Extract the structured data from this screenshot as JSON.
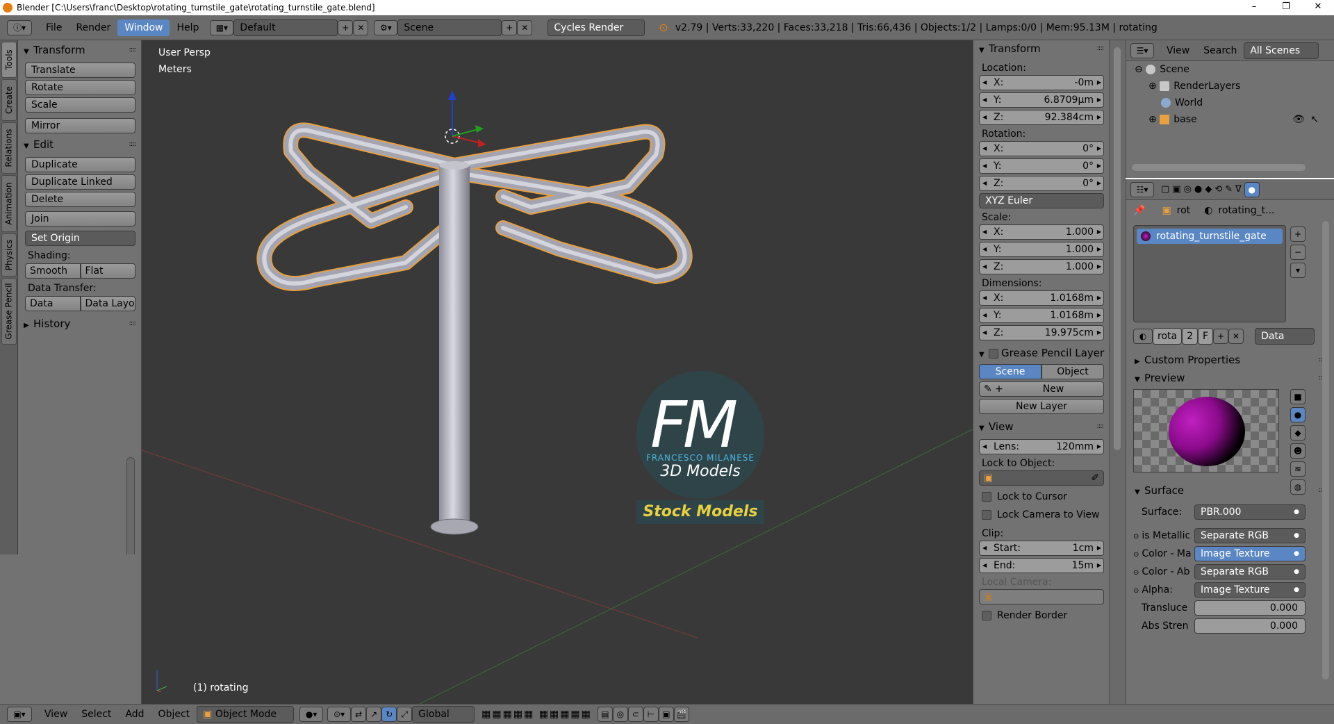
{
  "window": {
    "title": "Blender [C:\\Users\\franc\\Desktop\\rotating_turnstile_gate\\rotating_turnstile_gate.blend]",
    "controls": {
      "minimize": "–",
      "maximize": "❐",
      "close": "✕"
    }
  },
  "topbar": {
    "menus": [
      "File",
      "Render",
      "Window",
      "Help"
    ],
    "active_menu": "Window",
    "screen_layout": "Default",
    "scene": "Scene",
    "render_engine": "Cycles Render",
    "stats": "v2.79 | Verts:33,220 | Faces:33,218 | Tris:66,436 | Objects:1/2 | Lamps:0/0 | Mem:95.13M | rotating"
  },
  "tool_tabs": [
    "Tools",
    "Create",
    "Relations",
    "Animation",
    "Physics",
    "Grease Pencil"
  ],
  "toolshelf": {
    "transform": {
      "header": "Transform",
      "buttons": [
        "Translate",
        "Rotate",
        "Scale",
        "Mirror"
      ]
    },
    "edit": {
      "header": "Edit",
      "buttons": [
        "Duplicate",
        "Duplicate Linked",
        "Delete",
        "Join"
      ],
      "set_origin": "Set Origin",
      "shading_label": "Shading:",
      "shading": [
        "Smooth",
        "Flat"
      ],
      "data_transfer_label": "Data Transfer:",
      "data_transfer": [
        "Data",
        "Data Layo"
      ]
    },
    "history": {
      "header": "History"
    }
  },
  "viewport": {
    "perspective": "User Persp",
    "units": "Meters",
    "object_label": "(1) rotating",
    "watermark": {
      "initials": "FM",
      "name": "FRANCESCO MILANESE",
      "subtitle": "3D Models",
      "banner": "Stock Models"
    }
  },
  "npanel": {
    "transform_header": "Transform",
    "location_label": "Location:",
    "location": [
      {
        "k": "X:",
        "v": "-0m"
      },
      {
        "k": "Y:",
        "v": "6.8709µm"
      },
      {
        "k": "Z:",
        "v": "92.384cm"
      }
    ],
    "rotation_label": "Rotation:",
    "rotation": [
      {
        "k": "X:",
        "v": "0°"
      },
      {
        "k": "Y:",
        "v": "0°"
      },
      {
        "k": "Z:",
        "v": "0°"
      }
    ],
    "rotation_mode": "XYZ Euler",
    "scale_label": "Scale:",
    "scale": [
      {
        "k": "X:",
        "v": "1.000"
      },
      {
        "k": "Y:",
        "v": "1.000"
      },
      {
        "k": "Z:",
        "v": "1.000"
      }
    ],
    "dimensions_label": "Dimensions:",
    "dimensions": [
      {
        "k": "X:",
        "v": "1.0168m"
      },
      {
        "k": "Y:",
        "v": "1.0168m"
      },
      {
        "k": "Z:",
        "v": "19.975cm"
      }
    ],
    "grease_pencil_header": "Grease Pencil Layer",
    "gp_tabs": [
      "Scene",
      "Object"
    ],
    "gp_new": "New",
    "gp_new_layer": "New Layer",
    "view_header": "View",
    "lens_label": "Lens:",
    "lens_value": "120mm",
    "lock_to_object_label": "Lock to Object:",
    "lock_to_cursor": "Lock to Cursor",
    "lock_camera": "Lock Camera to View",
    "clip_label": "Clip:",
    "clip_start_label": "Start:",
    "clip_start": "1cm",
    "clip_end_label": "End:",
    "clip_end": "15m",
    "local_camera_label": "Local Camera:",
    "render_border": "Render Border"
  },
  "outliner": {
    "menus": [
      "View",
      "Search"
    ],
    "filter": "All Scenes",
    "items": [
      {
        "label": "Scene",
        "icon": "scene-icon",
        "indent": 0
      },
      {
        "label": "RenderLayers",
        "icon": "renderlayers-icon",
        "indent": 1
      },
      {
        "label": "World",
        "icon": "world-icon",
        "indent": 2
      },
      {
        "label": "base",
        "icon": "mesh-icon",
        "indent": 1
      }
    ]
  },
  "properties": {
    "breadcrumb": [
      "rot",
      "rotating_t..."
    ],
    "material_slot": "rotating_turnstile_gate",
    "datablock_name": "rota",
    "users": "2",
    "fake_user": "F",
    "link": "Data",
    "custom_properties": "Custom Properties",
    "preview": "Preview",
    "surface_header": "Surface",
    "surface_rows": [
      {
        "label": "Surface:",
        "value": "PBR.000"
      },
      {
        "label": "is Metallic",
        "value": "Separate RGB"
      },
      {
        "label": "Color - Ma",
        "value": "Image Texture"
      },
      {
        "label": "Color - Ab",
        "value": "Separate RGB"
      },
      {
        "label": "Alpha:",
        "value": "Image Texture"
      }
    ],
    "translucency_label": "Transluce",
    "translucency": "0.000",
    "abs_strength_label": "Abs Stren",
    "abs_strength": "0.000"
  },
  "bottombar": {
    "menus": [
      "View",
      "Select",
      "Add",
      "Object"
    ],
    "mode": "Object Mode",
    "orientation": "Global"
  },
  "colors": {
    "accent": "#5a86c4",
    "panel": "#727272",
    "viewport": "#393939",
    "material": "#8a0a8a"
  }
}
